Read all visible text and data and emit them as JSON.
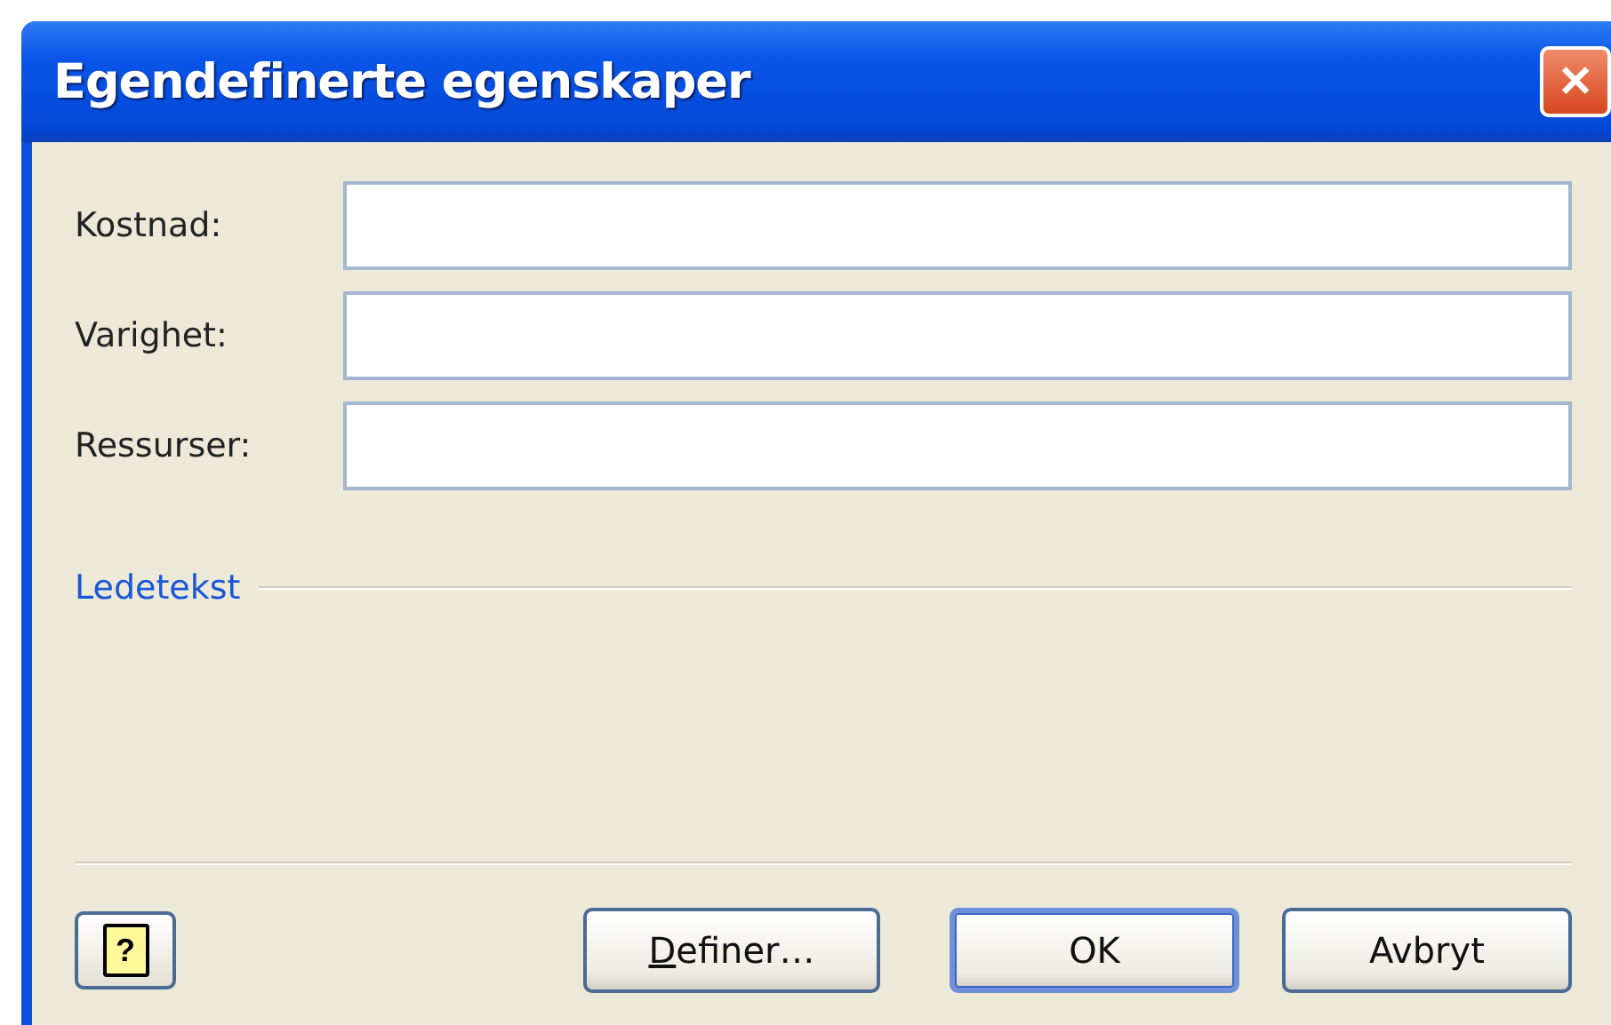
{
  "window": {
    "title": "Egendefinerte egenskaper",
    "close": "✕"
  },
  "fields": [
    {
      "label": "Kostnad:"
    },
    {
      "label": "Varighet:"
    },
    {
      "label": "Ressurser:"
    }
  ],
  "section": {
    "title": "Ledetekst"
  },
  "help_button": {
    "glyph": "?"
  },
  "buttons": [
    {
      "mnemonic": "D",
      "rest": "efiner…",
      "default": false
    },
    {
      "label": "OK",
      "default": true
    },
    {
      "label": "Avbryt",
      "default": false
    }
  ]
}
